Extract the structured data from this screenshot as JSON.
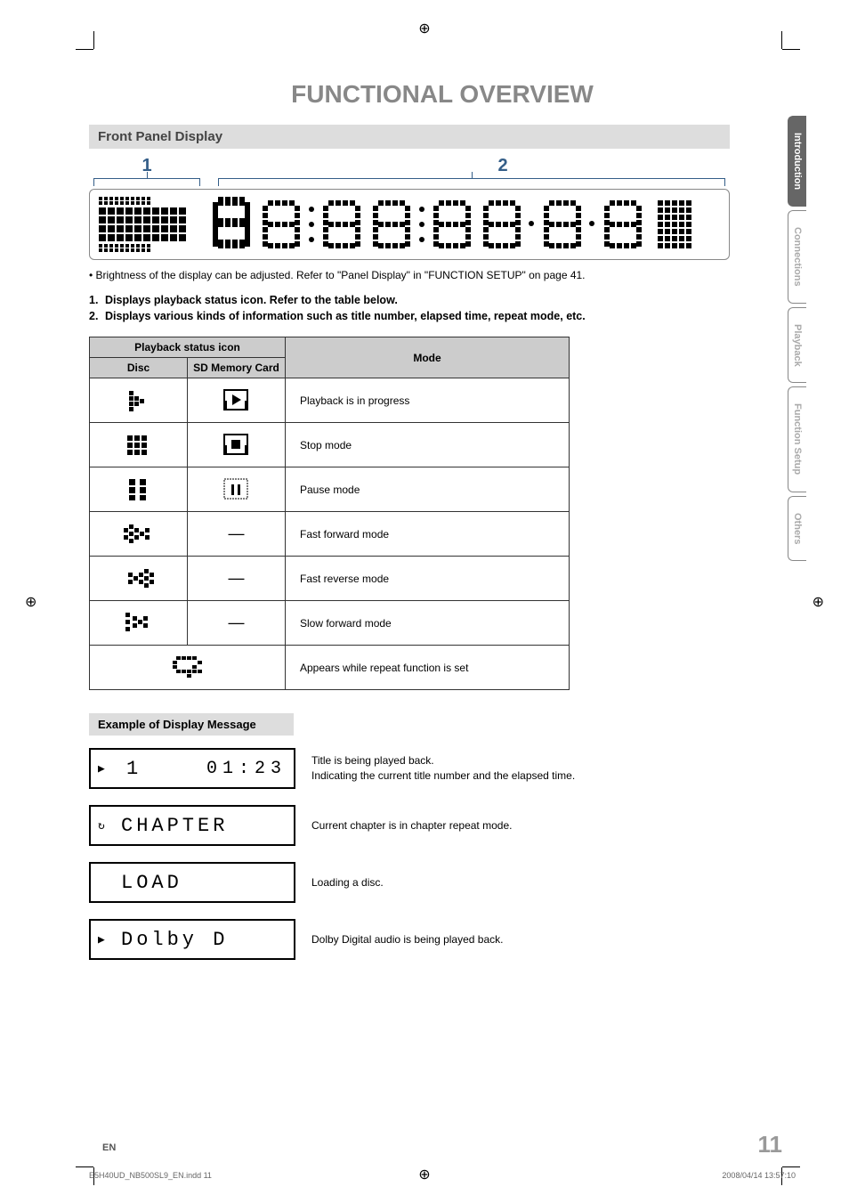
{
  "page": {
    "title": "FUNCTIONAL OVERVIEW",
    "section": "Front Panel Display",
    "marker1": "1",
    "marker2": "2",
    "note": "• Brightness of the display can be adjusted. Refer to \"Panel Display\" in \"FUNCTION SETUP\" on page 41.",
    "bullet1_num": "1.",
    "bullet1": "Displays playback status icon. Refer to the table below.",
    "bullet2_num": "2.",
    "bullet2": "Displays various kinds of information such as title number, elapsed time, repeat mode, etc."
  },
  "table": {
    "h_icon": "Playback status icon",
    "h_disc": "Disc",
    "h_sd": "SD Memory Card",
    "h_mode": "Mode",
    "rows": [
      {
        "desc": "Playback is in progress",
        "sd_dash": false
      },
      {
        "desc": "Stop mode",
        "sd_dash": false
      },
      {
        "desc": "Pause mode",
        "sd_dash": false
      },
      {
        "desc": "Fast forward mode",
        "sd_dash": true
      },
      {
        "desc": "Fast reverse mode",
        "sd_dash": true
      },
      {
        "desc": "Slow forward mode",
        "sd_dash": true
      },
      {
        "desc": "Appears while repeat function is set",
        "sd_dash": false,
        "span": true
      }
    ],
    "dash": "—"
  },
  "example": {
    "heading": "Example of Display Message",
    "rows": [
      {
        "lcd_left": "1",
        "lcd_right": "01:23",
        "desc1": "Title is being played back.",
        "desc2": "Indicating the current title number and the elapsed time."
      },
      {
        "lcd_text": "CHAPTER",
        "desc1": "Current chapter is in chapter repeat mode."
      },
      {
        "lcd_text": "LOAD",
        "desc1": "Loading a disc."
      },
      {
        "lcd_text": "Dolby D",
        "desc1": "Dolby Digital audio is being played back."
      }
    ]
  },
  "tabs": {
    "t1": "Introduction",
    "t2": "Connections",
    "t3": "Playback",
    "t4": "Function Setup",
    "t5": "Others"
  },
  "footer": {
    "en": "EN",
    "page_num": "11",
    "left": "E5H40UD_NB500SL9_EN.indd   11",
    "right": "2008/04/14   13:57:10"
  }
}
